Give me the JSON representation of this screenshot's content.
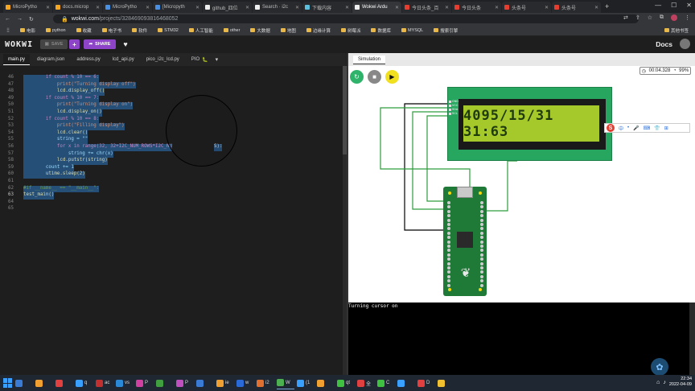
{
  "browser": {
    "tabs": [
      {
        "title": "MicroPytho",
        "color": "#f5a623"
      },
      {
        "title": "docs.microp",
        "color": "#f5a623"
      },
      {
        "title": "MicroPytho",
        "color": "#4a90e2"
      },
      {
        "title": "[Micropyth",
        "color": "#4a90e2"
      },
      {
        "title": "github_四位",
        "color": "#eeeeee"
      },
      {
        "title": "Search · i2c",
        "color": "#eeeeee"
      },
      {
        "title": "下载内容",
        "color": "#5bc0de"
      },
      {
        "title": "Wokwi Ardu",
        "color": "#eeeeee",
        "active": true
      },
      {
        "title": "今日头条_百",
        "color": "#e53d30"
      },
      {
        "title": "今日头条",
        "color": "#e53d30"
      },
      {
        "title": "头条号",
        "color": "#e53d30"
      },
      {
        "title": "头条号",
        "color": "#e53d30"
      }
    ],
    "new_tab": "+",
    "url_host": "wokwi.com",
    "url_path": "/projects/328469093816468052",
    "bookmarks": [
      "电影",
      "python",
      "收藏",
      "电子书",
      "软件",
      "STM32",
      "人工智能",
      "other",
      "大数据",
      "地图",
      "边缘计算",
      "树莓派",
      "数据库",
      "MYSQL",
      "搜索引擎"
    ],
    "other_bookmarks": "其他书签"
  },
  "wokwi": {
    "logo": "WOKWI",
    "save_label": "SAVE",
    "plus_label": "+",
    "share_label": "SHARE",
    "docs_label": "Docs"
  },
  "editor": {
    "tabs": [
      "main.py",
      "diagram.json",
      "address.py",
      "lcd_api.py",
      "pico_i2c_lcd.py",
      "PIO"
    ],
    "lines": [
      {
        "no": "46",
        "text": "        if count % 10 == 6:",
        "sel": true
      },
      {
        "no": "47",
        "text": "            print(\"Turning display off\")",
        "sel": true
      },
      {
        "no": "48",
        "text": "            lcd.display_off()",
        "sel": true
      },
      {
        "no": "49",
        "text": "        if count % 10 == 7:",
        "sel": true
      },
      {
        "no": "50",
        "text": "            print(\"Turning display on\")",
        "sel": true
      },
      {
        "no": "51",
        "text": "            lcd.display_on()",
        "sel": true
      },
      {
        "no": "52",
        "text": "        if count % 10 == 8:",
        "sel": true
      },
      {
        "no": "53",
        "text": "            print(\"Filling display\")",
        "sel": true
      },
      {
        "no": "54",
        "text": "            lcd.clear()",
        "sel": true
      },
      {
        "no": "55",
        "text": "            string = \"\"",
        "sel": true
      },
      {
        "no": "56",
        "text": "            for x in range(32, 32+I2C_NUM_ROWS*I2C_NU",
        "sel": true
      },
      {
        "no": "57",
        "text": "                string += chr(x)",
        "sel": true
      },
      {
        "no": "58",
        "text": "            lcd.putstr(string)",
        "sel": true
      },
      {
        "no": "59",
        "text": "        count += 1",
        "sel": true
      },
      {
        "no": "60",
        "text": "        utime.sleep(2)",
        "sel": true
      },
      {
        "no": "61",
        "text": "",
        "sel": true
      },
      {
        "no": "62",
        "text": "#if __name__ == \"__main__\":",
        "sel": true
      },
      {
        "no": "63",
        "text": "test_main()",
        "sel": true
      },
      {
        "no": "64",
        "text": "",
        "sel": false
      },
      {
        "no": "65",
        "text": "",
        "sel": false
      }
    ],
    "line56_tail": "S):"
  },
  "simulation": {
    "tab_label": "Simulation",
    "timer": "00:04.328",
    "speed": "99%",
    "lcd_text": "4095/15/31 31:63",
    "lcd_pins": [
      "GND",
      "VCC",
      "SDA",
      "SCL"
    ],
    "serial_output": "Turning cursor on",
    "ime_items": [
      "中",
      "•",
      "🎤",
      "⌨",
      "👕",
      "⊞"
    ]
  },
  "taskbar": {
    "apps": [
      {
        "label": "",
        "color": "#3a7bd5"
      },
      {
        "label": "",
        "color": "#f0a030"
      },
      {
        "label": "",
        "color": "#e04040"
      },
      {
        "label": "q",
        "color": "#3aa0ff"
      },
      {
        "label": "ac",
        "color": "#c03030"
      },
      {
        "label": "vs",
        "color": "#2a8ad8"
      },
      {
        "label": "P",
        "color": "#d040a0"
      },
      {
        "label": "",
        "color": "#40a040"
      },
      {
        "label": "P",
        "color": "#c050c0"
      },
      {
        "label": "",
        "color": "#3a7bd5"
      },
      {
        "label": "ie",
        "color": "#f0a030"
      },
      {
        "label": "w",
        "color": "#2a6ad8"
      },
      {
        "label": "i2",
        "color": "#e07030"
      },
      {
        "label": "W",
        "color": "#4caf50",
        "active": true
      },
      {
        "label": "(1",
        "color": "#3aa0ff"
      },
      {
        "label": "",
        "color": "#f0a030"
      },
      {
        "label": "qt",
        "color": "#40c040"
      },
      {
        "label": "全",
        "color": "#e04040"
      },
      {
        "label": "C",
        "color": "#40c040"
      },
      {
        "label": "",
        "color": "#3aa0ff"
      },
      {
        "label": "D",
        "color": "#e04040"
      },
      {
        "label": "",
        "color": "#f0c030"
      }
    ],
    "time": "22:34",
    "date": "2022-04-09"
  }
}
